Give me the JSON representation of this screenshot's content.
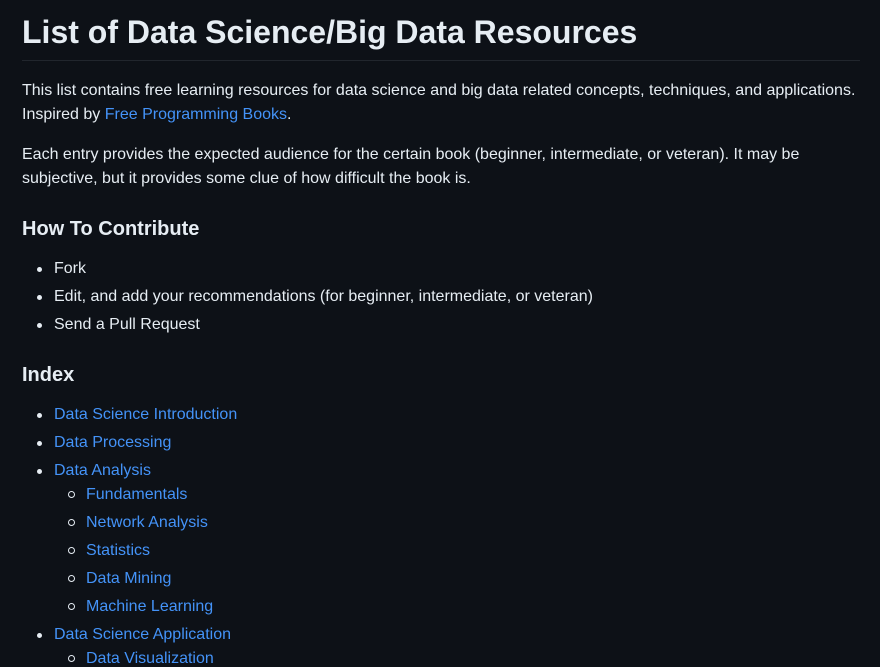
{
  "title": "List of Data Science/Big Data Resources",
  "intro": {
    "text": "This list contains free learning resources for data science and big data related concepts, techniques, and applications. Inspired by ",
    "link_label": "Free Programming Books",
    "suffix": "."
  },
  "audience_text": "Each entry provides the expected audience for the certain book (beginner, intermediate, or veteran). It may be subjective, but it provides some clue of how difficult the book is.",
  "contribute": {
    "heading": "How To Contribute",
    "items": [
      "Fork",
      "Edit, and add your recommendations (for beginner, intermediate, or veteran)",
      "Send a Pull Request"
    ]
  },
  "index": {
    "heading": "Index",
    "items": [
      {
        "label": "Data Science Introduction"
      },
      {
        "label": "Data Processing"
      },
      {
        "label": "Data Analysis",
        "children": [
          "Fundamentals",
          "Network Analysis",
          "Statistics",
          "Data Mining",
          "Machine Learning"
        ]
      },
      {
        "label": "Data Science Application",
        "children": [
          "Data Visualization"
        ]
      }
    ]
  },
  "colors": {
    "background": "#0d1117",
    "text": "#e6edf3",
    "link": "#4493f8",
    "divider": "#21262d"
  }
}
